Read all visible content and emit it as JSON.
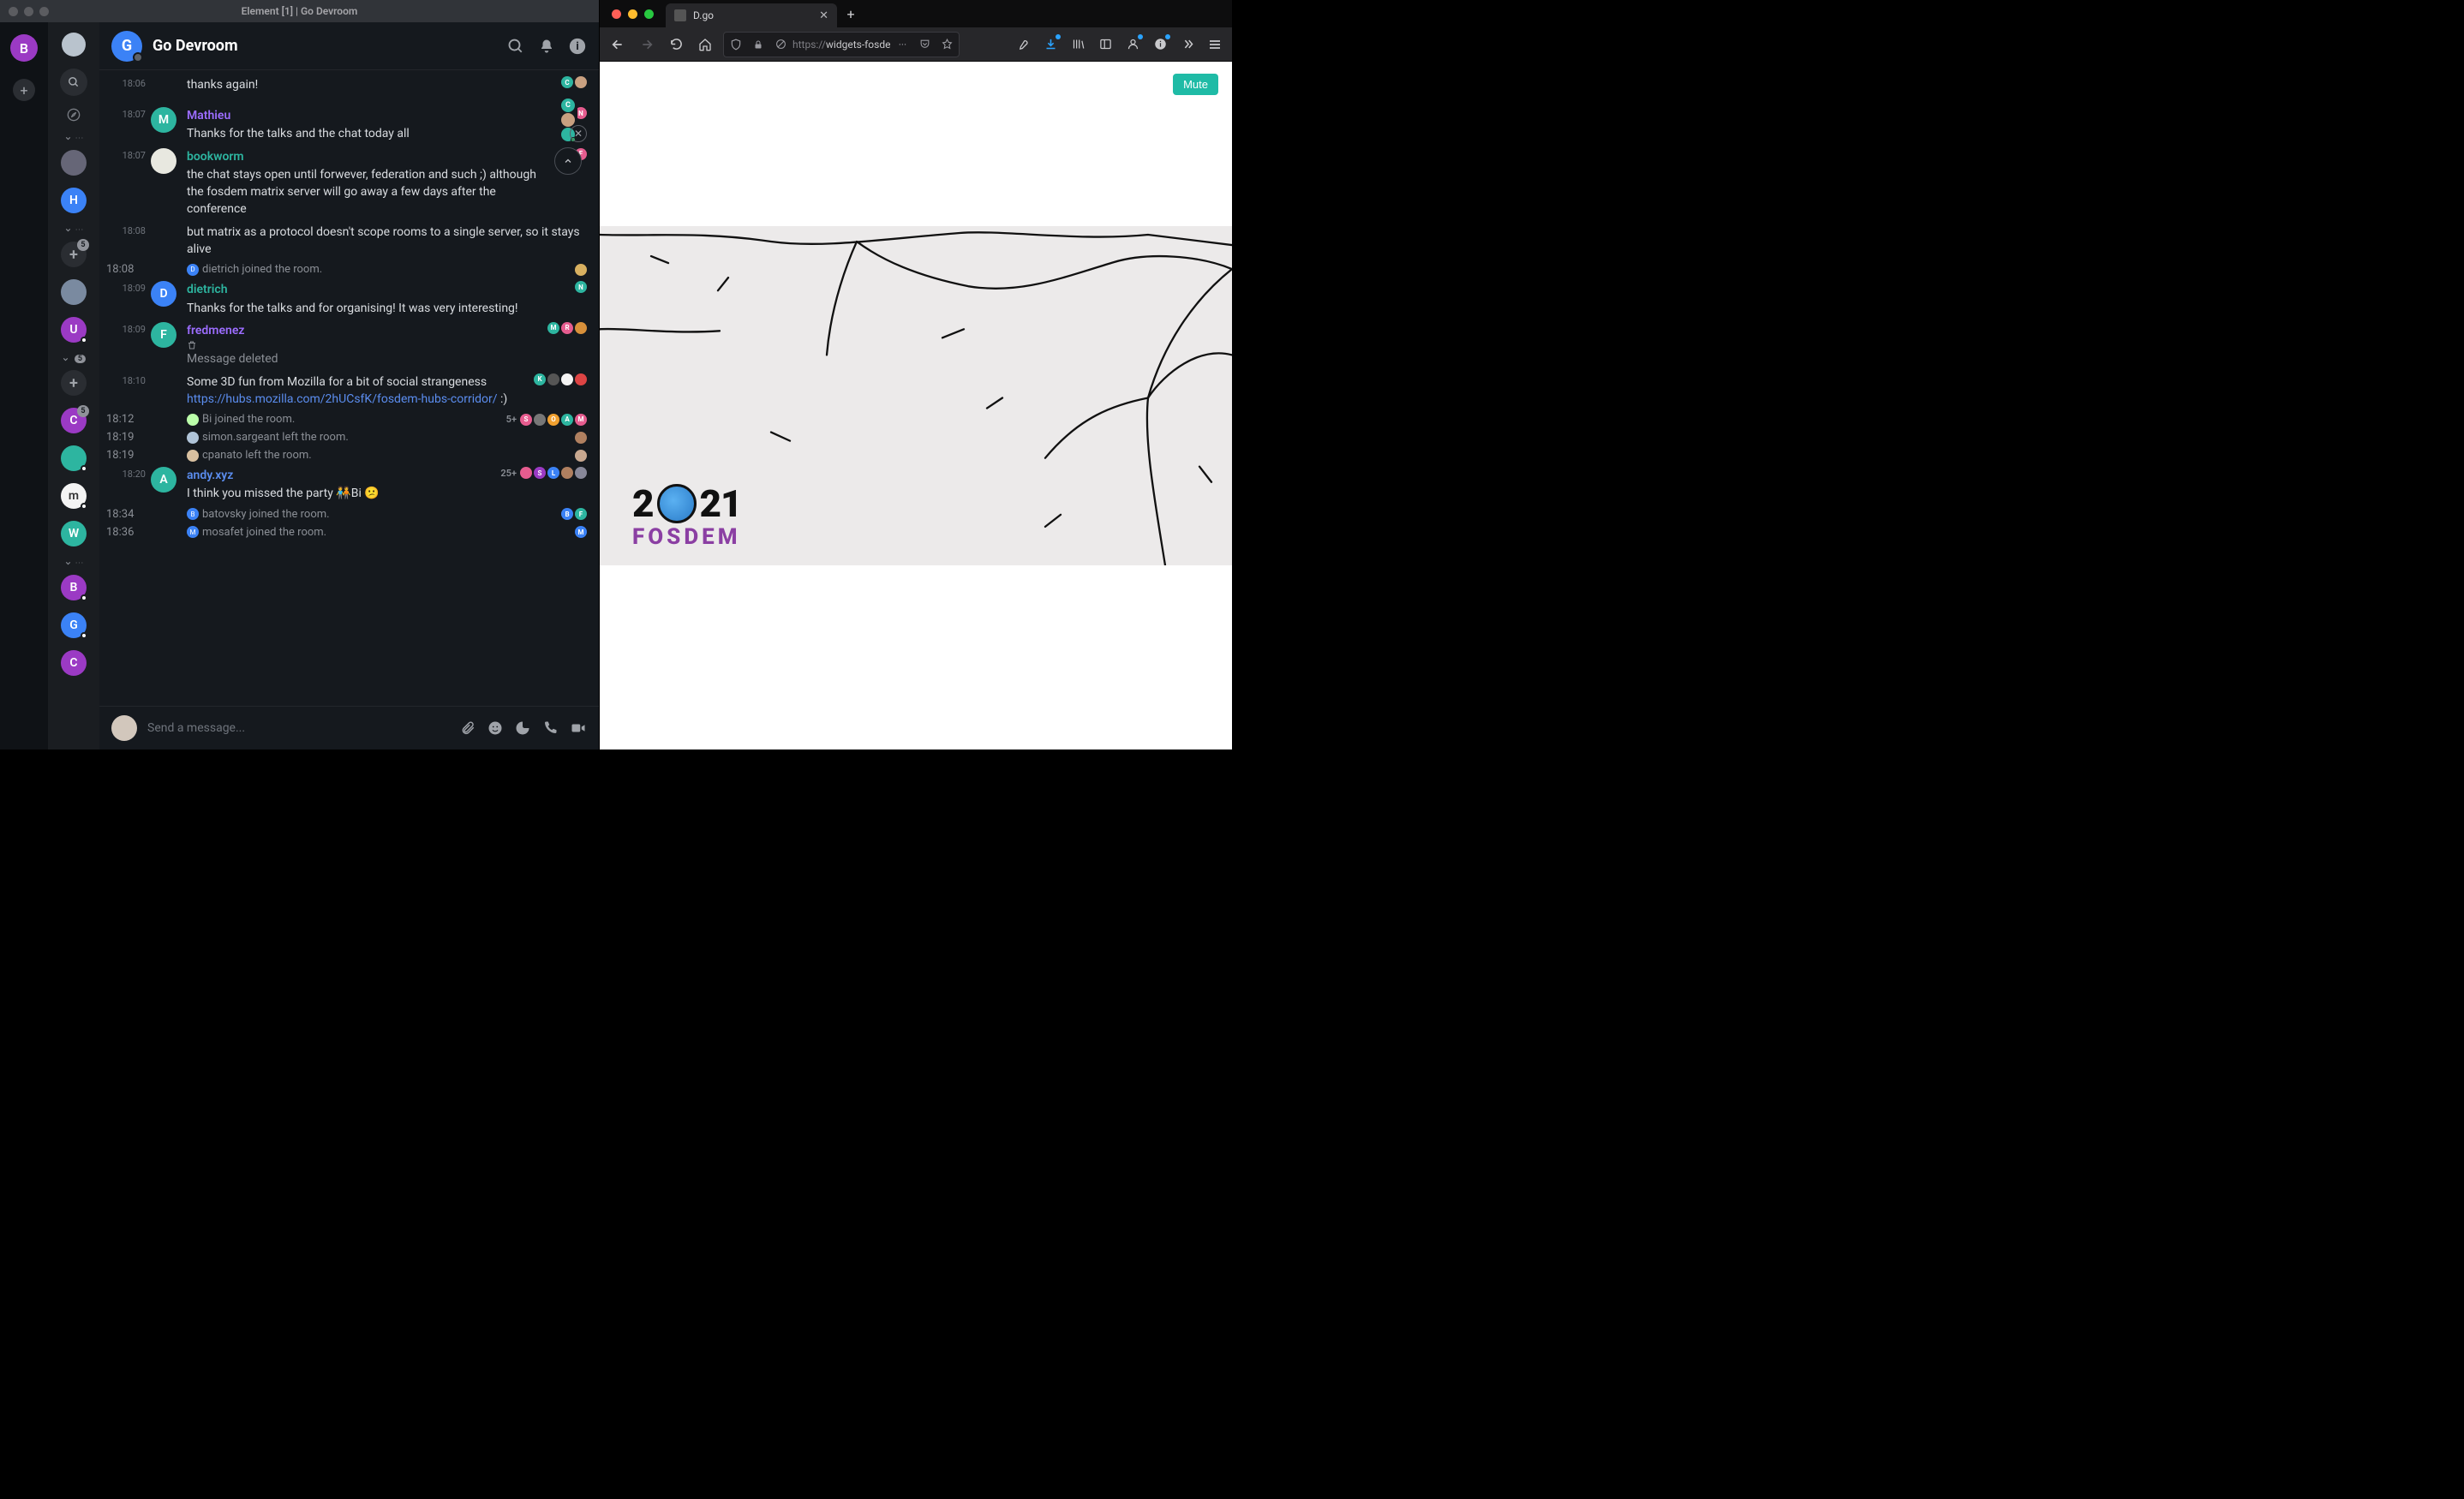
{
  "element": {
    "window_title": "Element [1] | Go Devroom",
    "space_letter": "B",
    "room_header": {
      "letter": "G",
      "name": "Go Devroom"
    },
    "composer_placeholder": "Send a message...",
    "rooms_sidebar": {
      "sections": [
        {
          "items": [
            {
              "label": "",
              "img": true
            },
            {
              "label": "H",
              "bg": "#3b82f6"
            }
          ]
        },
        {
          "items": [
            {
              "label": "+",
              "add": true,
              "badge": "5"
            },
            {
              "label": "",
              "bg": "#7a8aa0",
              "img": true
            },
            {
              "label": "U",
              "bg": "#9b3ac4",
              "dot": true
            }
          ]
        },
        {
          "badge": "5",
          "items": [
            {
              "label": "+",
              "add": true
            },
            {
              "label": "C",
              "bg": "#9b3ac4",
              "badge": "5"
            },
            {
              "label": "",
              "bg": "#2db5a0",
              "img": true,
              "dot": true
            },
            {
              "label": "m",
              "bg": "#f4f4f4",
              "fg": "#333",
              "dot": true
            },
            {
              "label": "W",
              "bg": "#2db5a0"
            }
          ]
        },
        {
          "items": [
            {
              "label": "B",
              "bg": "#9b3ac4",
              "dot": true
            },
            {
              "label": "G",
              "bg": "#3b82f6",
              "dot": true
            },
            {
              "label": "C",
              "bg": "#9b3ac4"
            }
          ]
        }
      ]
    },
    "timeline": [
      {
        "type": "msg",
        "ts": "18:06",
        "continuation": true,
        "text": "thanks again!",
        "receipts": [
          {
            "l": "C",
            "c": "#2db5a0"
          },
          {
            "l": "",
            "c": "#c8a080"
          }
        ]
      },
      {
        "type": "msg",
        "ts": "18:07",
        "avatar": {
          "l": "M",
          "c": "#2db5a0"
        },
        "sender": "Mathieu",
        "sender_color": "purple",
        "text": "Thanks for the talks and the chat today all",
        "receipts": [
          {
            "l": "D",
            "c": "#3b82f6"
          },
          {
            "l": "N",
            "c": "#e65c8f"
          }
        ]
      },
      {
        "type": "msg",
        "ts": "18:07",
        "avatar": {
          "l": "",
          "c": "#e8e8e0"
        },
        "sender": "bookworm",
        "sender_color": "teal",
        "text": "the chat stays open until forwever, federation and such ;) although the fosdem matrix server will go away a few days after the conference",
        "receipts": [
          {
            "l": "I",
            "c": "#6b7fff"
          },
          {
            "l": "F",
            "c": "#e65c8f"
          }
        ]
      },
      {
        "type": "msg",
        "ts": "18:08",
        "continuation": true,
        "text": "but matrix as a protocol doesn't scope rooms to a single server, so it stays alive"
      },
      {
        "type": "event",
        "ts": "18:08",
        "mini": {
          "l": "D",
          "c": "#3b82f6"
        },
        "text": "dietrich joined the room.",
        "receipts": [
          {
            "l": "",
            "c": "#d8b060"
          }
        ]
      },
      {
        "type": "msg",
        "ts": "18:09",
        "avatar": {
          "l": "D",
          "c": "#3b82f6"
        },
        "sender": "dietrich",
        "sender_color": "teal",
        "text": "Thanks for the talks and for organising! It was very interesting!",
        "receipts": [
          {
            "l": "N",
            "c": "#2db5a0"
          }
        ]
      },
      {
        "type": "msg",
        "ts": "18:09",
        "avatar": {
          "l": "F",
          "c": "#2db5a0"
        },
        "sender": "fredmenez",
        "sender_color": "purple",
        "deleted": true,
        "deleted_text": "Message deleted",
        "receipts": [
          {
            "l": "M",
            "c": "#2db5a0"
          },
          {
            "l": "R",
            "c": "#e65c8f"
          },
          {
            "l": "",
            "c": "#d8903a"
          }
        ]
      },
      {
        "type": "msg",
        "ts": "18:10",
        "continuation": true,
        "text": "Some 3D fun from Mozilla for a bit of social strangeness ",
        "link": "https://hubs.mozilla.com/2hUCsfK/fosdem-hubs-corridor/",
        "trail": "  :)",
        "receipts": [
          {
            "l": "K",
            "c": "#2db5a0"
          },
          {
            "l": "",
            "c": "#555"
          },
          {
            "l": "",
            "c": "#f4f4f4"
          },
          {
            "l": "",
            "c": "#d44"
          }
        ]
      },
      {
        "type": "event",
        "ts": "18:12",
        "mini": {
          "l": "",
          "c": "#bfa"
        },
        "text": "Bi joined the room.",
        "rr_count": "5+",
        "receipts": [
          {
            "l": "S",
            "c": "#e65c8f"
          },
          {
            "l": "",
            "c": "#777"
          },
          {
            "l": "O",
            "c": "#f0a030"
          },
          {
            "l": "A",
            "c": "#2db5a0"
          },
          {
            "l": "M",
            "c": "#e65c8f"
          }
        ]
      },
      {
        "type": "event",
        "ts": "18:19",
        "mini": {
          "l": "",
          "c": "#b0c4d8"
        },
        "text": "simon.sargeant left the room.",
        "receipts": [
          {
            "l": "",
            "c": "#b08060"
          }
        ]
      },
      {
        "type": "event",
        "ts": "18:19",
        "mini": {
          "l": "",
          "c": "#d8c0a0"
        },
        "text": "cpanato left the room.",
        "receipts": [
          {
            "l": "",
            "c": "#c8a890"
          }
        ]
      },
      {
        "type": "msg",
        "ts": "18:20",
        "avatar": {
          "l": "A",
          "c": "#2db5a0"
        },
        "sender": "andy.xyz",
        "sender_color": "blue",
        "text": "I think you missed the party 🧑‍🤝‍🧑Bi  😕",
        "rr_count": "25+",
        "receipts": [
          {
            "l": "",
            "c": "#e65c8f"
          },
          {
            "l": "S",
            "c": "#9b3ac4"
          },
          {
            "l": "L",
            "c": "#3b82f6"
          },
          {
            "l": "",
            "c": "#b08060"
          },
          {
            "l": "",
            "c": "#889"
          }
        ]
      },
      {
        "type": "event",
        "ts": "18:34",
        "mini": {
          "l": "B",
          "c": "#3b82f6"
        },
        "text": "batovsky joined the room.",
        "receipts": [
          {
            "l": "B",
            "c": "#3b82f6"
          },
          {
            "l": "F",
            "c": "#2db5a0"
          }
        ]
      },
      {
        "type": "event",
        "ts": "18:36",
        "mini": {
          "l": "M",
          "c": "#3b82f6"
        },
        "text": "mosafet joined the room.",
        "receipts": [
          {
            "l": "M",
            "c": "#3b82f6"
          }
        ]
      }
    ],
    "jump_stack": [
      {
        "l": "C",
        "c": "#2db5a0"
      },
      {
        "l": "",
        "c": "#c8a080"
      },
      {
        "l": "",
        "c": "#2db5a0",
        "green_dot": true
      }
    ]
  },
  "firefox": {
    "tab_title": "D.go",
    "url_proto": "https://",
    "url_rest": "widgets-fosde",
    "mute_label": "Mute",
    "logo": {
      "year_left": "2",
      "year_right": "21",
      "word": "FOSDEM"
    }
  }
}
